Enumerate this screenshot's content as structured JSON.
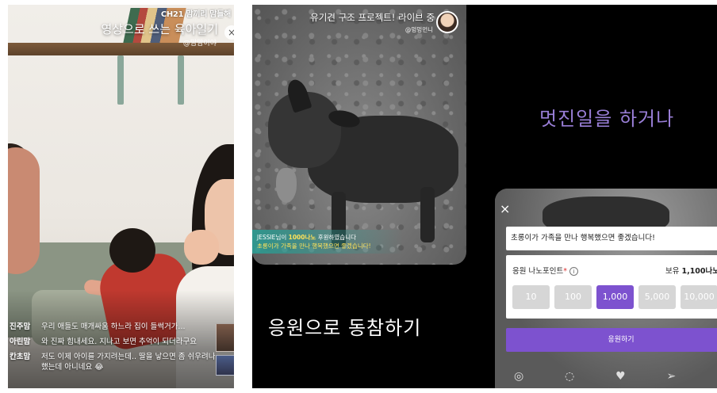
{
  "left": {
    "channel": "CH21 맘끼리 맘들해",
    "title": "영상으로 쓰는 육아일기",
    "author": "@맘맘이야",
    "chat": [
      {
        "user": "진주맘",
        "msg": "우리 애들도 매개싸움 하느라 집이 들썩거가..."
      },
      {
        "user": "아린맘",
        "msg": "와 진짜 힘내세요. 지나고 보면 추억이 되더라구요"
      },
      {
        "user": "칸초맘",
        "msg": "저도 이제 아이를 가지려는데.. 딸을 낳으면 좀 쉬우려나 했는데 아니네요 😂"
      }
    ]
  },
  "middle": {
    "title": "유기견 구조 프로젝트! 라이브 중",
    "author": "@멍멍먼니",
    "donation": {
      "donor": "JESSIE",
      "mid1": "님이 ",
      "amount": "1000나노",
      "mid2": " 후원하였습니다",
      "message": "초롱이가 가족을 만나 행복했으면 좋겠습니다!"
    },
    "headline": "응원으로 동참하기"
  },
  "right": {
    "headline": "멋진일을 하거나",
    "close": "×",
    "message": "초롱이가 가족을 만나 행복했으면 좋겠습니다!",
    "points_label": "응원 나노포인트",
    "points_required": "*",
    "info": "i",
    "holding_label": "보유 ",
    "holding_value": "1,100나노",
    "plus": "+",
    "amounts": [
      "10",
      "100",
      "1,000",
      "5,000",
      "10,000"
    ],
    "selected_amount": "1,000",
    "submit": "응원하기",
    "bar_icons": [
      "layers-icon",
      "chat-icon",
      "heart-icon",
      "send-icon",
      "more-icon"
    ]
  },
  "colors": {
    "accent": "#7d52cf",
    "headline_purple": "#9a7fd8",
    "donation_highlight": "#ffe25a"
  }
}
